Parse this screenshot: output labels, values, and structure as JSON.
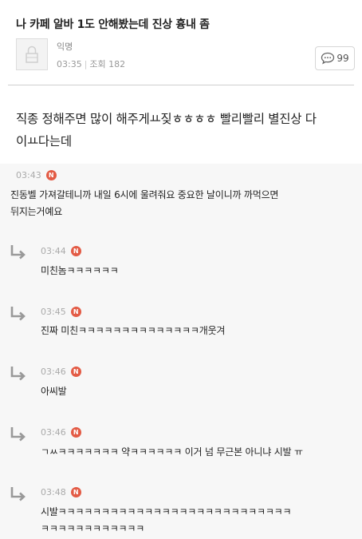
{
  "post": {
    "title": "나 카페 알바 1도 안해봤는데 진상 흉내 좀",
    "author": "익명",
    "time": "03:35",
    "views": "조회 182",
    "comment_count": "99",
    "body_line1": "직종 정해주면 많이 해주게ㅛ짖ㅎㅎㅎㅎ 빨리빨리 별진상 다",
    "body_line2": "이ㅛ다는데"
  },
  "comments": [
    {
      "time": "03:43",
      "badge": "N",
      "line1": "진동벨 가져갈테니까 내일 6시에 울려줘요 중요한 날이니까 까먹으면",
      "line2": "뒤지는거예요"
    },
    {
      "time": "03:44",
      "badge": "N",
      "line1": "미친놈ㅋㅋㅋㅋㅋㅋ",
      "reply": true
    },
    {
      "time": "03:45",
      "badge": "N",
      "line1": "진짜 미친ㅋㅋㅋㅋㅋㅋㅋㅋㅋㅋㅋㅋㅋㅋ개웃겨",
      "reply": true
    },
    {
      "time": "03:46",
      "badge": "N",
      "line1": "아씨발",
      "reply": true
    },
    {
      "time": "03:46",
      "badge": "N",
      "line1": "ㄱㅆㅋㅋㅋㅋㅋㅋㅋ 약ㅋㅋㅋㅋㅋㅋ 이거 넘 무근본 아니냐 시발 ㅠ",
      "reply": true
    },
    {
      "time": "03:48",
      "badge": "N",
      "line1": "시발ㅋㅋㅋㅋㅋㅋㅋㅋㅋㅋㅋㅋㅋㅋㅋㅋㅋㅋㅋㅋㅋㅋㅋㅋㅋㅋㅋ",
      "line2": "ㅋㅋㅋㅋㅋㅋㅋㅋㅋㅋㅋㅋ",
      "reply": true
    }
  ],
  "icons": {
    "avatar": "lock-icon",
    "comment": "speech-bubble-icon",
    "reply": "reply-arrow-icon"
  },
  "colors": {
    "badge": "#e35b45",
    "reply_arrow": "#999999"
  }
}
